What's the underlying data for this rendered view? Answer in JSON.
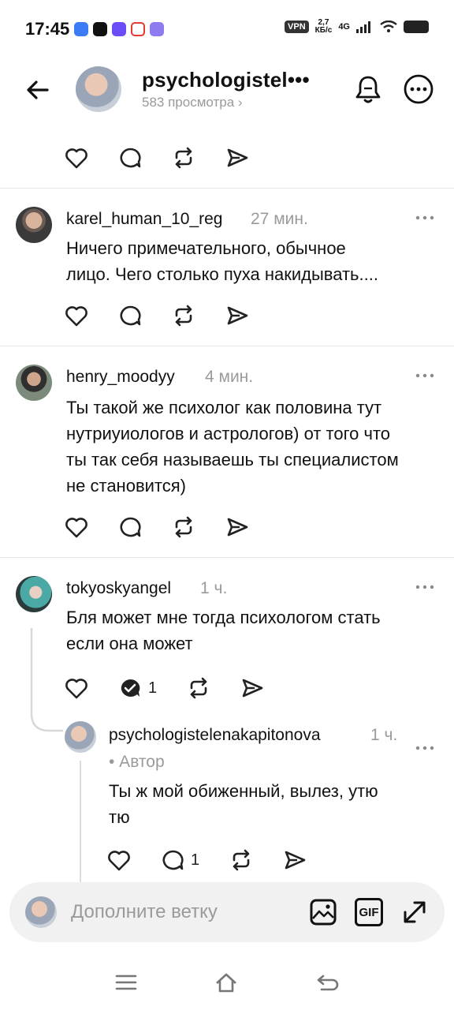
{
  "status_bar": {
    "time": "17:45",
    "vpn": "VPN",
    "speed_value": "2,7",
    "speed_unit": "КБ/с",
    "network": "4G"
  },
  "header": {
    "title": "psychologistel•••",
    "subtitle": "583 просмотра",
    "subtitle_chevron": "›"
  },
  "comments": [
    {
      "username": "karel_human_10_reg",
      "time": "27 мин.",
      "text_line1": "Ничего примечательного, обычное",
      "text_line2": "лицо. Чего столько пуха накидывать...."
    },
    {
      "username": "henry_moodyy",
      "time": "4 мин.",
      "text_line1": "Ты такой же психолог как половина тут",
      "text_line2": "нутриуиологов и астрологов) от того что",
      "text_line3": "ты так себя называешь ты специалистом",
      "text_line4": "не становится)"
    },
    {
      "username": "tokyoskyangel",
      "time": "1 ч.",
      "text_line1": "Бля может мне тогда психологом стать",
      "text_line2": "если она может",
      "reply_count": "1"
    }
  ],
  "reply": {
    "username": "psychologistelenakapitonova",
    "time": "1 ч.",
    "author_tag": "• Автор",
    "text_line1": "Ты ж мой обиженный, вылез, утю",
    "text_line2": "тю",
    "reply_count": "1"
  },
  "input": {
    "placeholder": "Дополните ветку",
    "gif_label": "GIF"
  },
  "icons": {
    "like": "heart-icon",
    "reply": "speech-bubble-icon",
    "repost": "repost-icon",
    "share": "send-icon",
    "more": "more-dots-icon",
    "bell": "bell-icon",
    "back": "arrow-left-icon"
  },
  "colors": {
    "text": "#111111",
    "muted": "#9a9a9a",
    "divider": "#e6e6e6",
    "input_bg": "#f1f1f1"
  }
}
